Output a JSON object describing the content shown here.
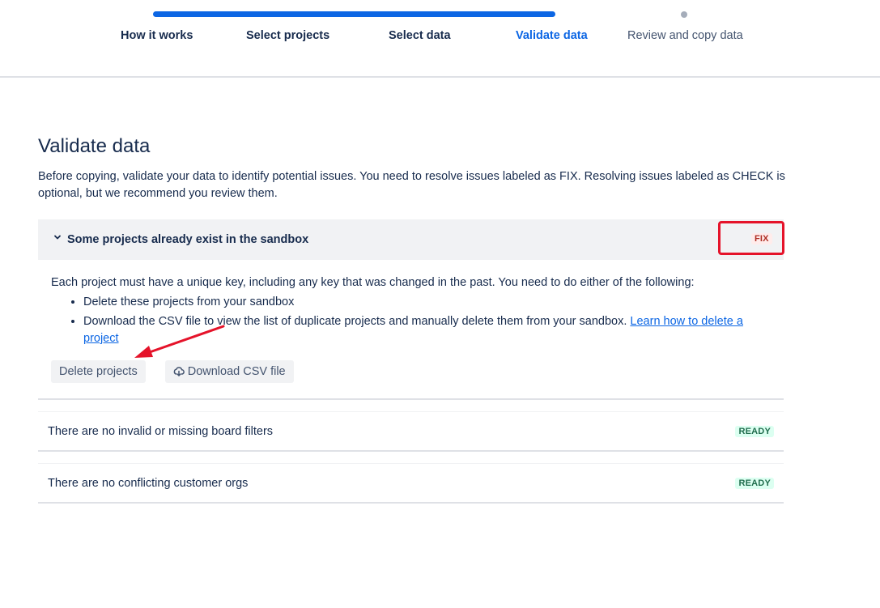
{
  "stepper": {
    "steps": [
      {
        "label": "How it works"
      },
      {
        "label": "Select projects"
      },
      {
        "label": "Select data"
      },
      {
        "label": "Validate data"
      },
      {
        "label": "Review and copy data"
      }
    ],
    "progress_completed_steps": 4,
    "progress_total_steps": 5
  },
  "page": {
    "title": "Validate data",
    "intro": "Before copying, validate your data to identify potential issues. You need to resolve issues labeled as FIX. Resolving issues labeled as CHECK is optional, but we recommend you review them."
  },
  "checks": {
    "projects": {
      "title": "Some projects already exist in the sandbox",
      "status": "FIX",
      "description": "Each project must have a unique key, including any key that was changed in the past. You need to do either of the following:",
      "bullet_1": "Delete these projects from your sandbox",
      "bullet_2_text": "Download the CSV file to view the list of duplicate projects and manually delete them from your sandbox. ",
      "bullet_2_link": "Learn how to delete a project",
      "delete_button": "Delete projects",
      "download_button": "Download CSV file"
    },
    "boards": {
      "title": "There are no invalid or missing board filters",
      "status": "READY"
    },
    "orgs": {
      "title": "There are no conflicting customer orgs",
      "status": "READY"
    }
  },
  "colors": {
    "accent": "#0c66e4",
    "fix": "#ae2e24",
    "ready": "#216e4e",
    "annotation": "#e5132a"
  }
}
